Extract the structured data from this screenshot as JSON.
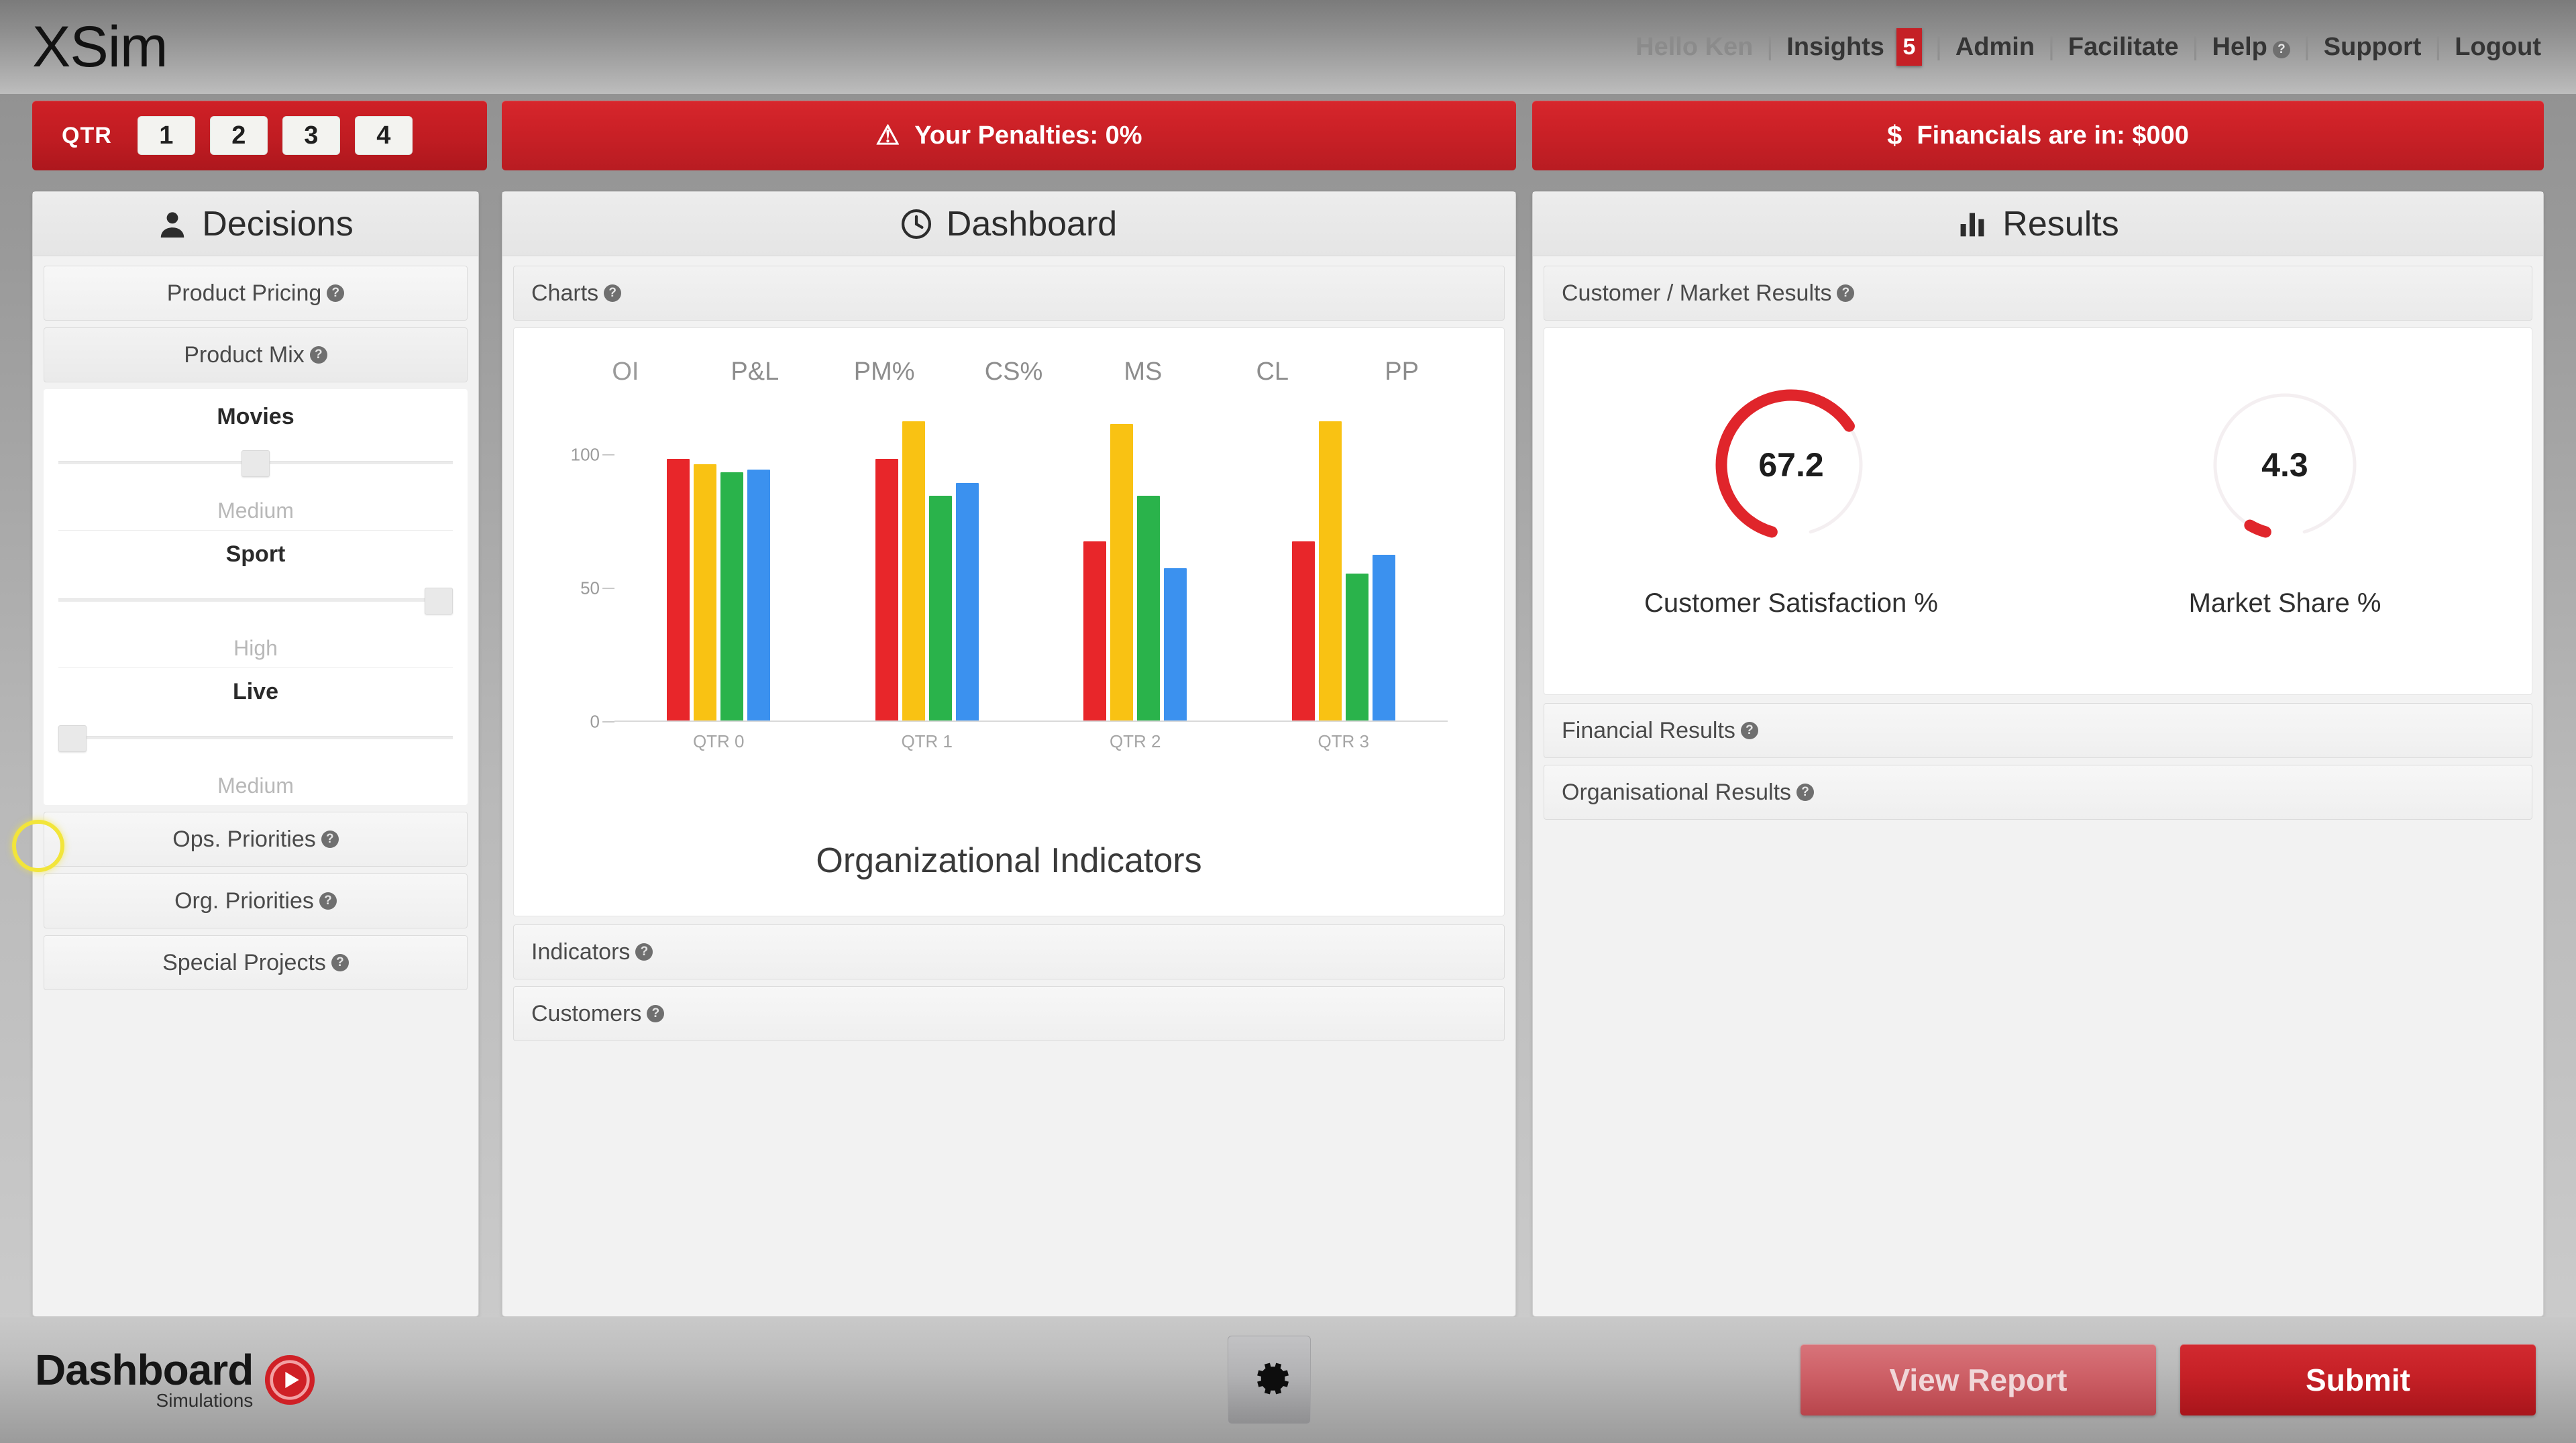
{
  "header": {
    "brand": "XSim",
    "nav": [
      {
        "label": "Hello Ken",
        "dim": true,
        "badge": null
      },
      {
        "label": "Insights",
        "dim": false,
        "badge": "5"
      },
      {
        "label": "Admin",
        "dim": false,
        "badge": null
      },
      {
        "label": "Facilitate",
        "dim": false,
        "badge": null
      },
      {
        "label": "Help",
        "dim": false,
        "badge": null,
        "help": true
      },
      {
        "label": "Support",
        "dim": false,
        "badge": null
      },
      {
        "label": "Logout",
        "dim": false,
        "badge": null
      }
    ],
    "separator": "|"
  },
  "stripes": {
    "qtr_label": "QTR",
    "qtr_buttons": [
      "1",
      "2",
      "3",
      "4"
    ],
    "penalties": {
      "icon": "warning-triangle-icon",
      "text": "Your Penalties: 0%"
    },
    "financials": {
      "icon": "dollar-sign-icon",
      "text": "Financials are in: $000"
    },
    "accent_red": "#c52026"
  },
  "decisions": {
    "title": "Decisions",
    "icon": "user-icon",
    "sections": [
      {
        "label": "Product Pricing",
        "help": "?",
        "open": false
      },
      {
        "label": "Product Mix",
        "help": "?",
        "open": true
      }
    ],
    "sliders": [
      {
        "name": "Movies",
        "value": "Medium",
        "position_pct": 50
      },
      {
        "name": "Sport",
        "value": "High",
        "position_pct": 100
      },
      {
        "name": "Live",
        "value": "Medium",
        "position_pct": 0
      }
    ],
    "bottom_sections": [
      {
        "label": "Ops. Priorities",
        "help": "?"
      },
      {
        "label": "Org. Priorities",
        "help": "?"
      },
      {
        "label": "Special Projects",
        "help": "?"
      }
    ]
  },
  "dashboard": {
    "title": "Dashboard",
    "icon": "clock-icon",
    "charts_section": {
      "label": "Charts",
      "help": "?"
    },
    "sections": [
      {
        "label": "Indicators",
        "help": "?"
      },
      {
        "label": "Customers",
        "help": "?"
      }
    ]
  },
  "chart_data": {
    "type": "bar",
    "title": "Organizational Indicators",
    "tabs": [
      "OI",
      "P&L",
      "PM%",
      "CS%",
      "MS",
      "CL",
      "PP"
    ],
    "active_tab": "OI",
    "categories": [
      "QTR 0",
      "QTR 1",
      "QTR 2",
      "QTR 3"
    ],
    "series": [
      {
        "name": "series-1",
        "color": "#e8262a",
        "values": [
          98,
          98,
          67,
          67
        ]
      },
      {
        "name": "series-2",
        "color": "#f9c213",
        "values": [
          96,
          112,
          111,
          112
        ]
      },
      {
        "name": "series-3",
        "color": "#2ab34b",
        "values": [
          93,
          84,
          84,
          55
        ]
      },
      {
        "name": "series-4",
        "color": "#3b91ef",
        "values": [
          94,
          89,
          57,
          62
        ]
      }
    ],
    "yticks": [
      0,
      50,
      100
    ],
    "ylim": [
      0,
      118
    ],
    "xlabel": "",
    "ylabel": "",
    "grid": false,
    "legend": "none"
  },
  "results": {
    "title": "Results",
    "icon": "bar-chart-icon",
    "customer_market": {
      "label": "Customer / Market Results",
      "help": "?"
    },
    "gauges": [
      {
        "label": "Customer Satisfaction %",
        "value": "67.2",
        "pct": 67.2,
        "color": "#e0252b"
      },
      {
        "label": "Market Share %",
        "value": "4.3",
        "pct": 4.3,
        "color": "#e0252b"
      }
    ],
    "sections": [
      {
        "label": "Financial Results",
        "help": "?"
      },
      {
        "label": "Organisational Results",
        "help": "?"
      }
    ]
  },
  "footer": {
    "logo_main": "Dashboard",
    "logo_sub": "Simulations",
    "logo_icon": "target-play-icon",
    "gear_icon": "gear-icon",
    "view_report_label": "View Report",
    "submit_label": "Submit"
  }
}
